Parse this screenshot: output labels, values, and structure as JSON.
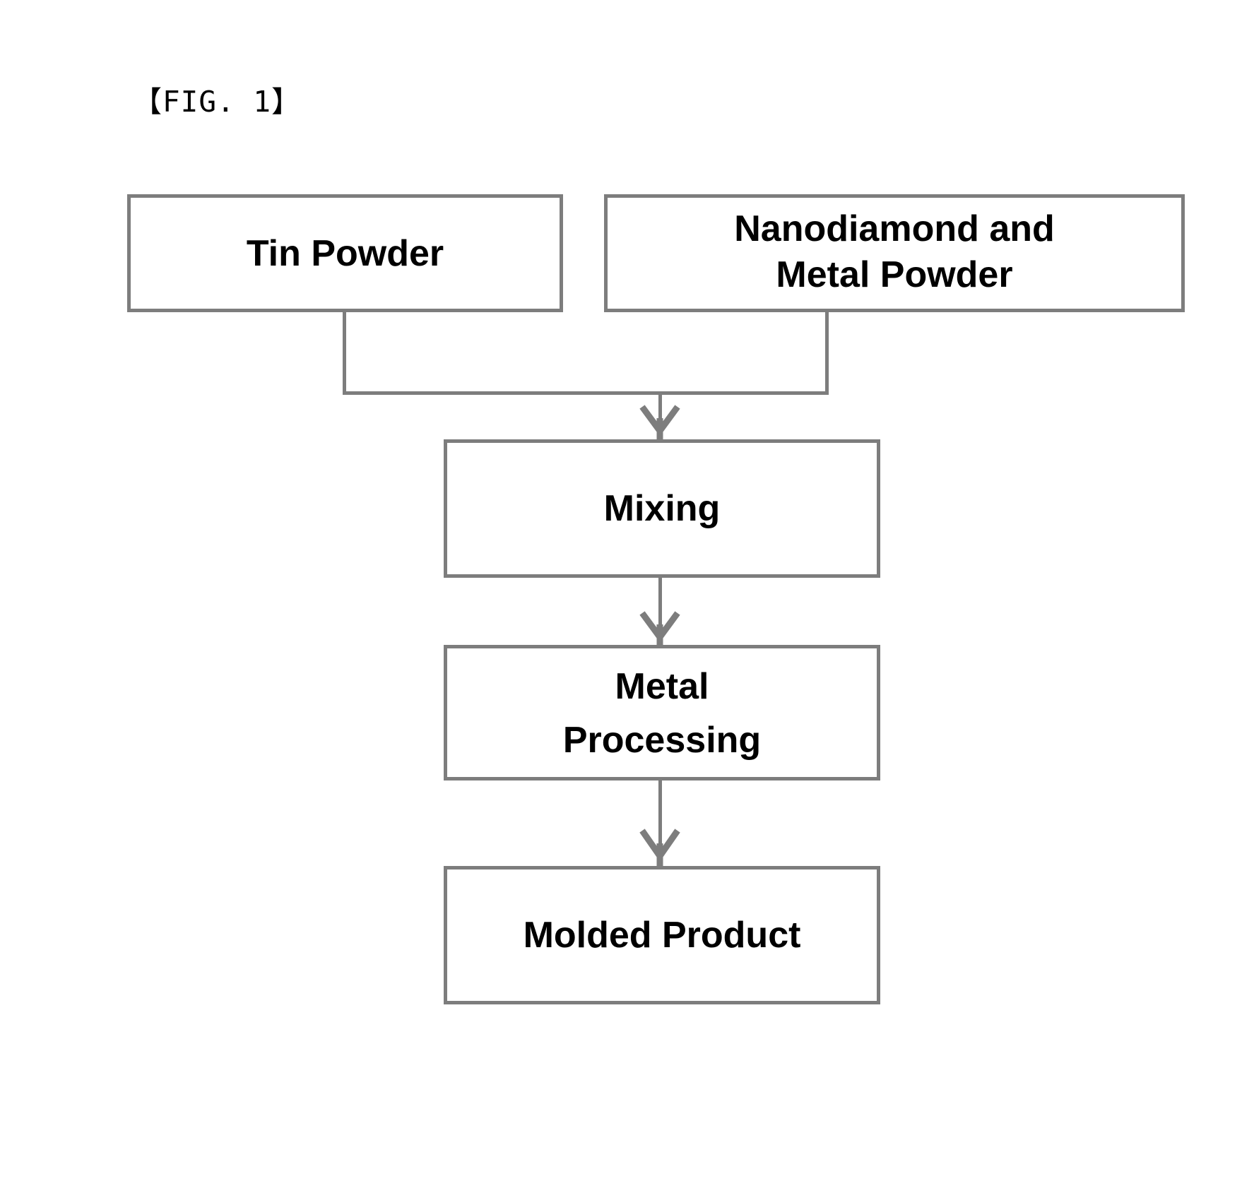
{
  "figure": {
    "label": "【FIG. 1】",
    "caption_text": "FIG. 1",
    "type": "process-flow-diagram",
    "background_color": "#ffffff",
    "line_color": "#7d7d7d",
    "text_color": "#000000"
  },
  "nodes": {
    "tin_powder": {
      "id": "tin-powder",
      "label": "Tin Powder",
      "lines": [
        "Tin Powder"
      ]
    },
    "nanodiamond_metal_powder": {
      "id": "nanodiamond-and-metal-powder",
      "label": "Nanodiamond and Metal Powder",
      "lines": [
        "Nanodiamond and",
        "Metal Powder"
      ]
    },
    "mixing": {
      "id": "mixing",
      "label": "Mixing",
      "lines": [
        "Mixing"
      ]
    },
    "metal_processing": {
      "id": "metal-processing",
      "label": "Metal Processing",
      "lines": [
        "Metal",
        "Processing"
      ]
    },
    "molded_product": {
      "id": "molded-product",
      "label": "Molded Product",
      "lines": [
        "Molded Product"
      ]
    }
  },
  "edges": [
    {
      "from": "tin_powder",
      "to": "mixing",
      "style": "elbow-merge-arrow"
    },
    {
      "from": "nanodiamond_metal_powder",
      "to": "mixing",
      "style": "elbow-merge-arrow"
    },
    {
      "from": "mixing",
      "to": "metal_processing",
      "style": "straight-arrow"
    },
    {
      "from": "metal_processing",
      "to": "molded_product",
      "style": "straight-arrow"
    }
  ]
}
